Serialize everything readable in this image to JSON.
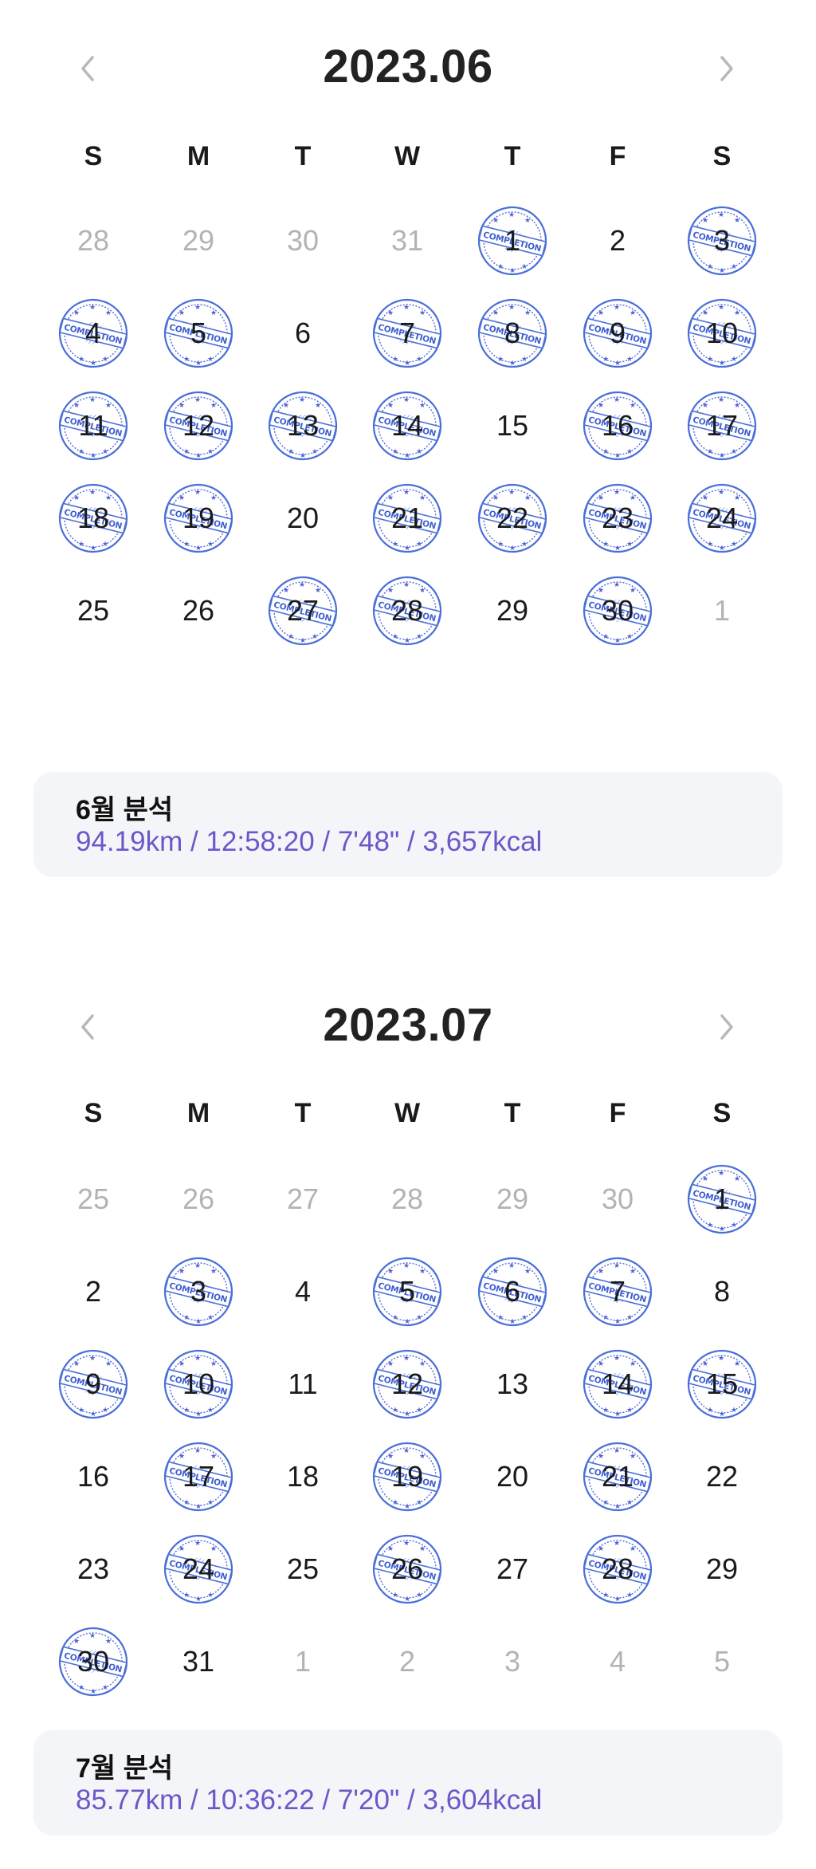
{
  "icons": {
    "prev": "chevron-left-icon",
    "next": "chevron-right-icon",
    "stamp": "completion-stamp-icon"
  },
  "colors": {
    "stats_text": "#6e56c9",
    "stamp": "#4a6fd8",
    "card_bg": "#f4f5f9",
    "muted_day": "#b3b3b3"
  },
  "stamp_text": "COMPLETION",
  "months": [
    {
      "title": "2023.06",
      "weekdays": [
        "S",
        "M",
        "T",
        "W",
        "T",
        "F",
        "S"
      ],
      "weeks": [
        [
          {
            "d": "28",
            "m": true
          },
          {
            "d": "29",
            "m": true
          },
          {
            "d": "30",
            "m": true
          },
          {
            "d": "31",
            "m": true
          },
          {
            "d": "1",
            "s": true
          },
          {
            "d": "2"
          },
          {
            "d": "3",
            "s": true
          }
        ],
        [
          {
            "d": "4",
            "s": true
          },
          {
            "d": "5",
            "s": true
          },
          {
            "d": "6"
          },
          {
            "d": "7",
            "s": true
          },
          {
            "d": "8",
            "s": true
          },
          {
            "d": "9",
            "s": true
          },
          {
            "d": "10",
            "s": true
          }
        ],
        [
          {
            "d": "11",
            "s": true
          },
          {
            "d": "12",
            "s": true
          },
          {
            "d": "13",
            "s": true
          },
          {
            "d": "14",
            "s": true
          },
          {
            "d": "15"
          },
          {
            "d": "16",
            "s": true
          },
          {
            "d": "17",
            "s": true
          }
        ],
        [
          {
            "d": "18",
            "s": true
          },
          {
            "d": "19",
            "s": true
          },
          {
            "d": "20"
          },
          {
            "d": "21",
            "s": true
          },
          {
            "d": "22",
            "s": true
          },
          {
            "d": "23",
            "s": true
          },
          {
            "d": "24",
            "s": true
          }
        ],
        [
          {
            "d": "25"
          },
          {
            "d": "26"
          },
          {
            "d": "27",
            "s": true
          },
          {
            "d": "28",
            "s": true
          },
          {
            "d": "29"
          },
          {
            "d": "30",
            "s": true
          },
          {
            "d": "1",
            "m": true
          }
        ]
      ],
      "summary": {
        "title": "6월 분석",
        "stats": "94.19km / 12:58:20 / 7'48\" / 3,657kcal"
      }
    },
    {
      "title": "2023.07",
      "weekdays": [
        "S",
        "M",
        "T",
        "W",
        "T",
        "F",
        "S"
      ],
      "weeks": [
        [
          {
            "d": "25",
            "m": true
          },
          {
            "d": "26",
            "m": true
          },
          {
            "d": "27",
            "m": true
          },
          {
            "d": "28",
            "m": true
          },
          {
            "d": "29",
            "m": true
          },
          {
            "d": "30",
            "m": true
          },
          {
            "d": "1",
            "s": true
          }
        ],
        [
          {
            "d": "2"
          },
          {
            "d": "3",
            "s": true
          },
          {
            "d": "4"
          },
          {
            "d": "5",
            "s": true
          },
          {
            "d": "6",
            "s": true
          },
          {
            "d": "7",
            "s": true
          },
          {
            "d": "8"
          }
        ],
        [
          {
            "d": "9",
            "s": true
          },
          {
            "d": "10",
            "s": true
          },
          {
            "d": "11"
          },
          {
            "d": "12",
            "s": true
          },
          {
            "d": "13"
          },
          {
            "d": "14",
            "s": true
          },
          {
            "d": "15",
            "s": true
          }
        ],
        [
          {
            "d": "16"
          },
          {
            "d": "17",
            "s": true
          },
          {
            "d": "18"
          },
          {
            "d": "19",
            "s": true
          },
          {
            "d": "20"
          },
          {
            "d": "21",
            "s": true
          },
          {
            "d": "22"
          }
        ],
        [
          {
            "d": "23"
          },
          {
            "d": "24",
            "s": true
          },
          {
            "d": "25"
          },
          {
            "d": "26",
            "s": true
          },
          {
            "d": "27"
          },
          {
            "d": "28",
            "s": true
          },
          {
            "d": "29"
          }
        ],
        [
          {
            "d": "30",
            "s": true
          },
          {
            "d": "31"
          },
          {
            "d": "1",
            "m": true
          },
          {
            "d": "2",
            "m": true
          },
          {
            "d": "3",
            "m": true
          },
          {
            "d": "4",
            "m": true
          },
          {
            "d": "5",
            "m": true
          }
        ]
      ],
      "summary": {
        "title": "7월 분석",
        "stats": "85.77km / 10:36:22 / 7'20\" / 3,604kcal"
      }
    }
  ]
}
